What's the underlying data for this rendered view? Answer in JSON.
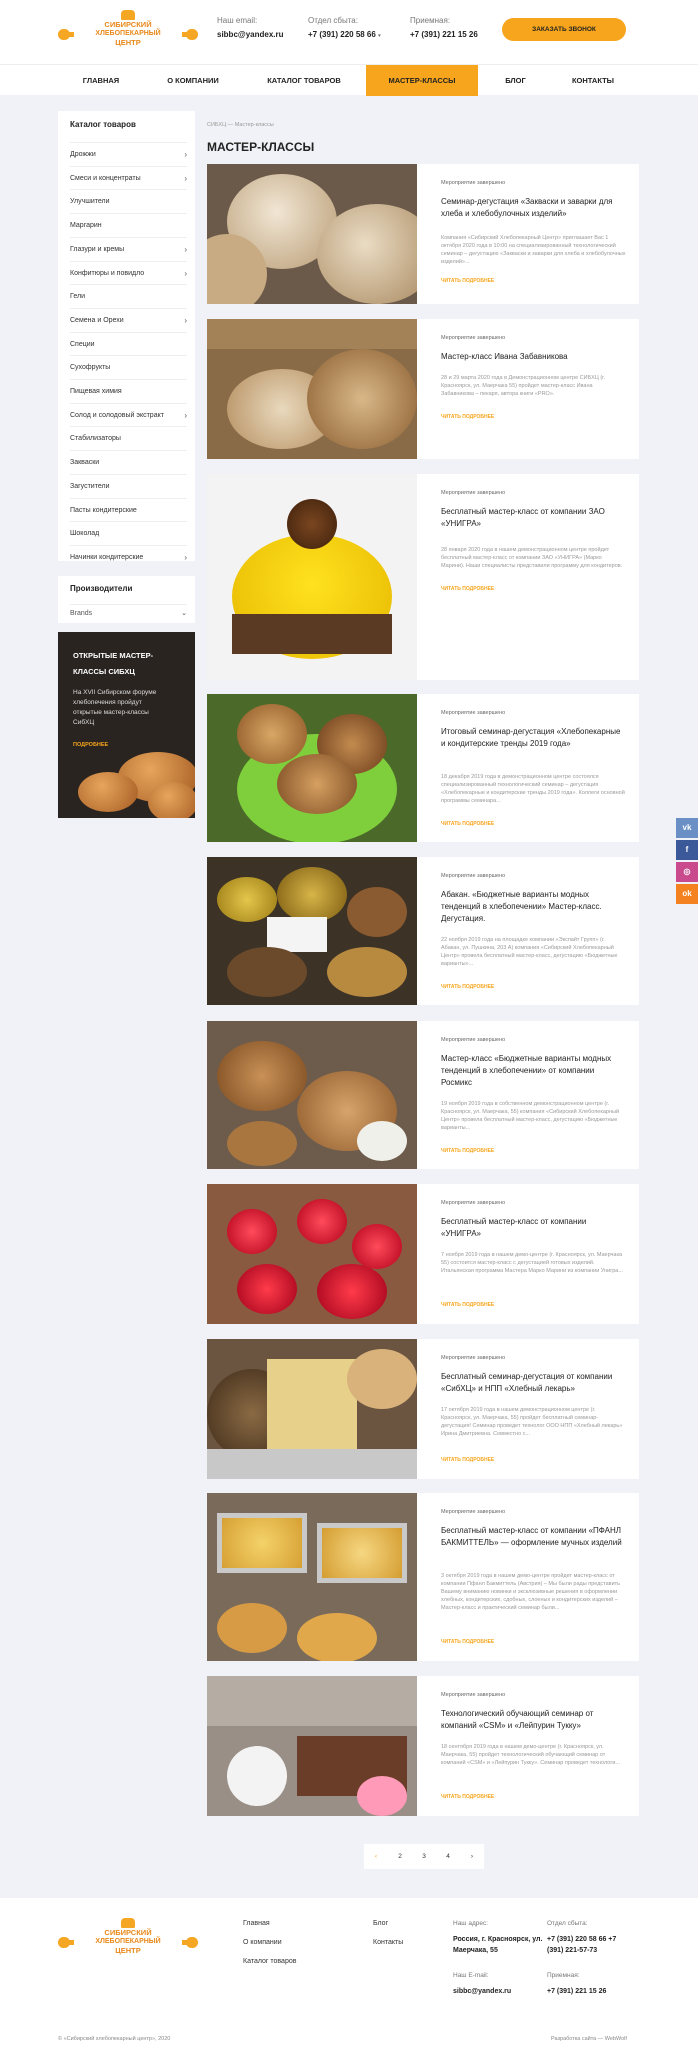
{
  "header": {
    "logo": [
      "СИБИРСКИЙ",
      "ХЛЕБОПЕКАРНЫЙ",
      "ЦЕНТР"
    ],
    "email_label": "Наш email:",
    "email": "sibbc@yandex.ru",
    "sales_label": "Отдел сбыта:",
    "sales_phone": "+7 (391) 220 58 66",
    "reception_label": "Приемная:",
    "reception_phone": "+7 (391) 221 15 26",
    "order_button": "ЗАКАЗАТЬ ЗВОНОК"
  },
  "nav": [
    "ГЛАВНАЯ",
    "О КОМПАНИИ",
    "КАТАЛОГ ТОВАРОВ",
    "МАСТЕР-КЛАССЫ",
    "БЛОГ",
    "КОНТАКТЫ"
  ],
  "sidebar": {
    "catalog_title": "Каталог товаров",
    "items": [
      {
        "label": "Дрожжи",
        "arrow": true
      },
      {
        "label": "Смеси и концентраты",
        "arrow": true
      },
      {
        "label": "Улучшители",
        "arrow": false
      },
      {
        "label": "Маргарин",
        "arrow": false
      },
      {
        "label": "Глазури и кремы",
        "arrow": true
      },
      {
        "label": "Конфитюры и повидло",
        "arrow": true
      },
      {
        "label": "Гели",
        "arrow": false
      },
      {
        "label": "Семена и Орехи",
        "arrow": true
      },
      {
        "label": "Специи",
        "arrow": false
      },
      {
        "label": "Сухофрукты",
        "arrow": false
      },
      {
        "label": "Пищевая химия",
        "arrow": false
      },
      {
        "label": "Солод и солодовый экстракт",
        "arrow": true
      },
      {
        "label": "Стабилизаторы",
        "arrow": false
      },
      {
        "label": "Закваски",
        "arrow": false
      },
      {
        "label": "Загустители",
        "arrow": false
      },
      {
        "label": "Пасты кондитерские",
        "arrow": false
      },
      {
        "label": "Шоколад",
        "arrow": false
      },
      {
        "label": "Начинки кондитерские",
        "arrow": true
      }
    ],
    "brands_title": "Производители",
    "brands_select": "Brands",
    "promo_title": "ОТКРЫТЫЕ МАСТЕР-КЛАССЫ СИБХЦ",
    "promo_text": "На XVII Сибирском форуме хлебопечения пройдут открытые мастер-классы СибХЦ",
    "promo_link": "ПОДРОБНЕЕ"
  },
  "breadcrumbs": "СИБХЦ — Мастер-классы",
  "page_title": "МАСТЕР-КЛАССЫ",
  "cards": [
    {
      "status": "Мероприятие завершено",
      "title": "Семинар-дегустация «Закваски и заварки для хлеба и хлебобулочных изделий»",
      "text": "Компания «Сибирский Хлебопекарный Центр» приглашает Вас 1 октября 2020 года в 10:00 на специализированный технологический семинар – дегустацию «Закваски и заварки для хлеба и хлебобулочных изделий»...",
      "more": "ЧИТАТЬ ПОДРОБНЕЕ"
    },
    {
      "status": "Мероприятие завершено",
      "title": "Мастер-класс Ивана Забавникова",
      "text": "28 и 29 марта 2020 года в Демонстрационном центре СИБХЦ (г. Красноярск, ул. Маерчака 55) пройдет мастер-класс Ивана Забавникова – пекаря, автора книги «PRO».",
      "more": "ЧИТАТЬ ПОДРОБНЕЕ"
    },
    {
      "status": "Мероприятие завершено",
      "title": "Бесплатный мастер-класс от компании ЗАО «УНИГРА»",
      "text": "28 января 2020 года в нашем демонстрационном центре пройдет бесплатный мастер-класс от компании ЗАО «УНИГРА» (Марко Марини). Наши специалисты представили программу для кондитеров.",
      "more": "ЧИТАТЬ ПОДРОБНЕЕ"
    },
    {
      "status": "Мероприятие завершено",
      "title": "Итоговый семинар-дегустация «Хлебопекарные и кондитерские тренды 2019 года»",
      "text": "18 декабря 2019 года в демонстрационном центре состоялся специализированный технологический семинар – дегустация «Хлебопекарные и кондитерские тренды 2019 года». Коллеги основной программы семинара...",
      "more": "ЧИТАТЬ ПОДРОБНЕЕ"
    },
    {
      "status": "Мероприятие завершено",
      "title": "Абакан. «Бюджетные варианты модных тенденций в хлебопечении» Мастер-класс. Дегустация.",
      "text": "22 ноября 2019 года на площадке компании «Экспайт Групп» (г. Абакан, ул. Пушкина, 203 А) компания «Сибирский Хлебопекарный Центр» провела бесплатный мастер-класс, дегустацию «Бюджетные варианты»...",
      "more": "ЧИТАТЬ ПОДРОБНЕЕ"
    },
    {
      "status": "Мероприятие завершено",
      "title": "Мастер-класс «Бюджетные варианты модных тенденций в хлебопечении» от компании Росмикс",
      "text": "19 ноября 2019 года в собственном демонстрационном центре (г. Красноярск, ул. Маерчака, 55) компания «Сибирский Хлебопекарный Центр» провела бесплатный мастер-класс, дегустацию «Бюджетные варианты...",
      "more": "ЧИТАТЬ ПОДРОБНЕЕ"
    },
    {
      "status": "Мероприятие завершено",
      "title": "Бесплатный мастер-класс от компании «УНИГРА»",
      "text": "7 ноября 2019 года в нашем демо-центре (г. Красноярск, ул. Маерчака 55) состоится мастер-класс с дегустацией готовых изделий. Итальянская программа Мастера Марко Марини из компании Унигра...",
      "more": "ЧИТАТЬ ПОДРОБНЕЕ"
    },
    {
      "status": "Мероприятие завершено",
      "title": "Бесплатный семинар-дегустация от компании «СибХЦ» и НПП «Хлебный лекарь»",
      "text": "17 октября 2019 года в нашем демонстрационном центре (г. Красноярск, ул. Маерчака, 55) пройдет бесплатный семинар-дегустация! Семинар проведет технолог ООО НПП «Хлебный лекарь» Ирина Дмитриевна. Совместно с...",
      "more": "ЧИТАТЬ ПОДРОБНЕЕ"
    },
    {
      "status": "Мероприятие завершено",
      "title": "Бесплатный мастер-класс от компании «ПФАНЛ БАКМИТТЕЛЬ» — оформление мучных изделий",
      "text": "3 октября 2019 года в нашем демо-центре пройдет мастер-класс от компании Пфанл Бакмиттель (Австрия) – Мы были рады представить Вашему вниманию новинки и эксклюзивные решения в оформлении хлебных, кондитерских, сдобных, слоеных и кондитерских изделий – Мастер-класс и практический семинар были...",
      "more": "ЧИТАТЬ ПОДРОБНЕЕ"
    },
    {
      "status": "Мероприятие завершено",
      "title": "Технологический обучающий семинар от компаний «CSM» и «Лейпурин Тукку»",
      "text": "18 сентября 2019 года в нашем демо-центре (г. Красноярск, ул. Маерчака, 55) пройдет технологический обучающий семинар от компаний «CSM» и «Лейпурин Тукку». Семинар проведет технологи...",
      "more": "ЧИТАТЬ ПОДРОБНЕЕ"
    }
  ],
  "pager": [
    "‹",
    "2",
    "3",
    "4",
    "›"
  ],
  "footer": {
    "links_col1": [
      "Главная",
      "О компании",
      "Каталог товаров"
    ],
    "links_col2": [
      "Блог",
      "Контакты"
    ],
    "addr_label": "Наш адрес:",
    "addr": "Россия, г. Красноярск, ул. Маерчака, 55",
    "sales_label": "Отдел сбыта:",
    "sales_phones": "+7 (391) 220 58 66 +7 (391) 221-57-73",
    "email_label": "Наш E-mail:",
    "email": "sibbc@yandex.ru",
    "reception_label": "Приемная:",
    "reception_phone": "+7 (391) 221 15 26",
    "copyright": "© «Сибирский хлебопекарный центр», 2020",
    "dev": "Разработка сайта — WebWolf"
  },
  "social": [
    "vk",
    "f",
    "ok",
    "mail"
  ],
  "colors": {
    "accent": "#f7a51c",
    "bg": "#f0f2f7"
  }
}
